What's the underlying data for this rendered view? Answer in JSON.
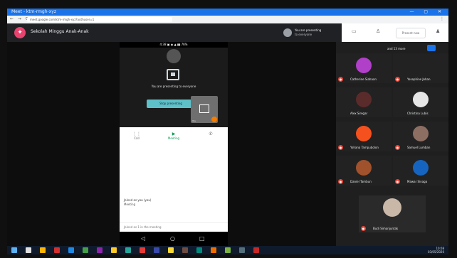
{
  "browser": {
    "window_title": "Meet - ktm-rmgh-xyz",
    "url": "meet.google.com/ktm-rmgh-xyz?authuser=1"
  },
  "meeting": {
    "title": "Sekolah Minggu Anak-Anak",
    "presenter_line1": "You are presenting",
    "presenter_line2": "to everyone",
    "present_button": "Present now"
  },
  "phone": {
    "status": "4:38  ▣ ◉ ▲  ▮▮ 76%",
    "presenting_caption": "You are presenting to everyone",
    "stop_button": "Stop presenting",
    "self_name": "You",
    "tabs": [
      {
        "icon": "⋮⋮",
        "label": "Call"
      },
      {
        "icon": "▶",
        "label": "Meeting"
      },
      {
        "icon": "✆",
        "label": ""
      }
    ],
    "sheet_line1": "Joined as you (you)",
    "sheet_line2": "Meeting",
    "sheet_footer": "Joined as 1 in the meeting",
    "nav": {
      "back": "◁",
      "home": "○",
      "recent": "□"
    }
  },
  "participants": {
    "more_label": "and 13 more",
    "tiles": [
      {
        "name": "Catherine Siahaan",
        "color": "#b040c8"
      },
      {
        "name": "Yosephine Johan",
        "color": "#222222"
      },
      {
        "name": "Alex Siregar",
        "color": "#5a2b2b"
      },
      {
        "name": "Christina Lubis",
        "color": "#e6e6e6"
      },
      {
        "name": "Yohana Tampubolon",
        "color": "#f4511e"
      },
      {
        "name": "Samuel Lumban",
        "color": "#8d6e63"
      },
      {
        "name": "Daniel Tambun",
        "color": "#a0522d"
      },
      {
        "name": "Mawar Sinaga",
        "color": "#1565c0"
      },
      {
        "name": "Budi Simanjuntak",
        "color": "#c9b8a8"
      }
    ]
  },
  "taskbar": {
    "time": "10:08",
    "date": "03/05/2020",
    "icons": [
      "#5db1f0",
      "#e0e0e0",
      "#ffb300",
      "#d32f2f",
      "#1e88e5",
      "#43a047",
      "#8e24aa",
      "#ffca28",
      "#26a69a",
      "#e53935",
      "#3949ab",
      "#fdd835",
      "#6d4c41",
      "#00897b",
      "#ef6c00",
      "#7cb342",
      "#546e7a",
      "#c62828"
    ]
  }
}
